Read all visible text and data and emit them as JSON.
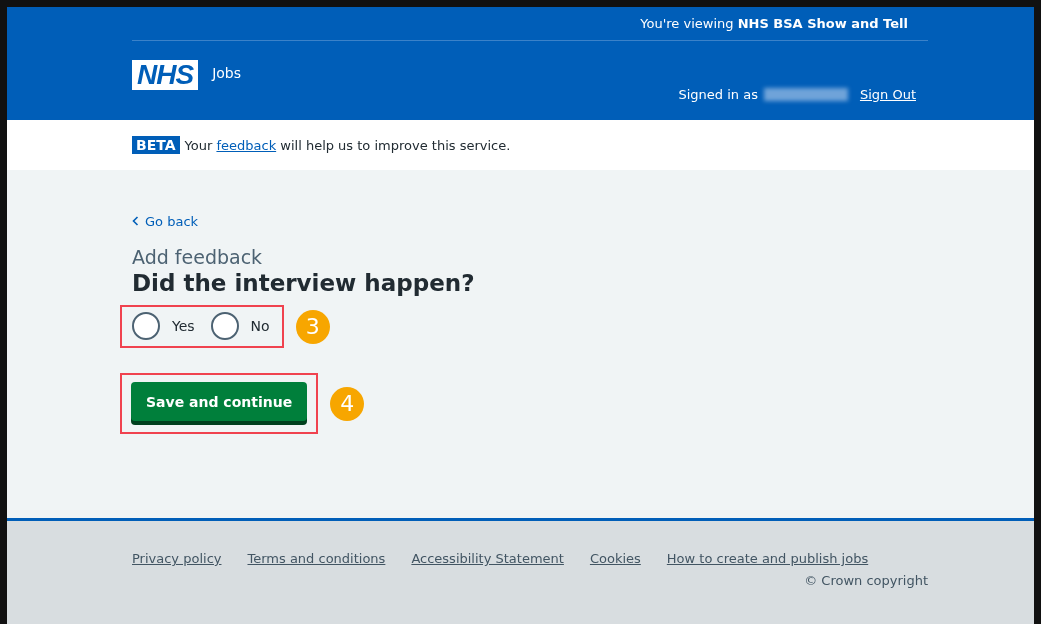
{
  "header": {
    "viewing": "You're viewing **NHS BSA Show and Tell**",
    "logo": "NHS",
    "service": "Jobs",
    "signed_in_label": "Signed in as",
    "sign_out": "Sign Out"
  },
  "beta_banner": {
    "tag": "BETA",
    "before": "Your",
    "link": "feedback",
    "after": "will help us to improve this service."
  },
  "back_link": "Go back",
  "caption": "Add feedback",
  "question": "Did the interview happen?",
  "options": [
    {
      "label": "Yes",
      "selected": false
    },
    {
      "label": "No",
      "selected": false
    }
  ],
  "options_marker": "3",
  "button": "Save and continue",
  "button_marker": "4",
  "footer": {
    "links": [
      "Privacy policy",
      "Terms and conditions",
      "Accessibility Statement",
      "Cookies",
      "How to create and publish jobs"
    ],
    "copyright": "© Crown copyright"
  }
}
